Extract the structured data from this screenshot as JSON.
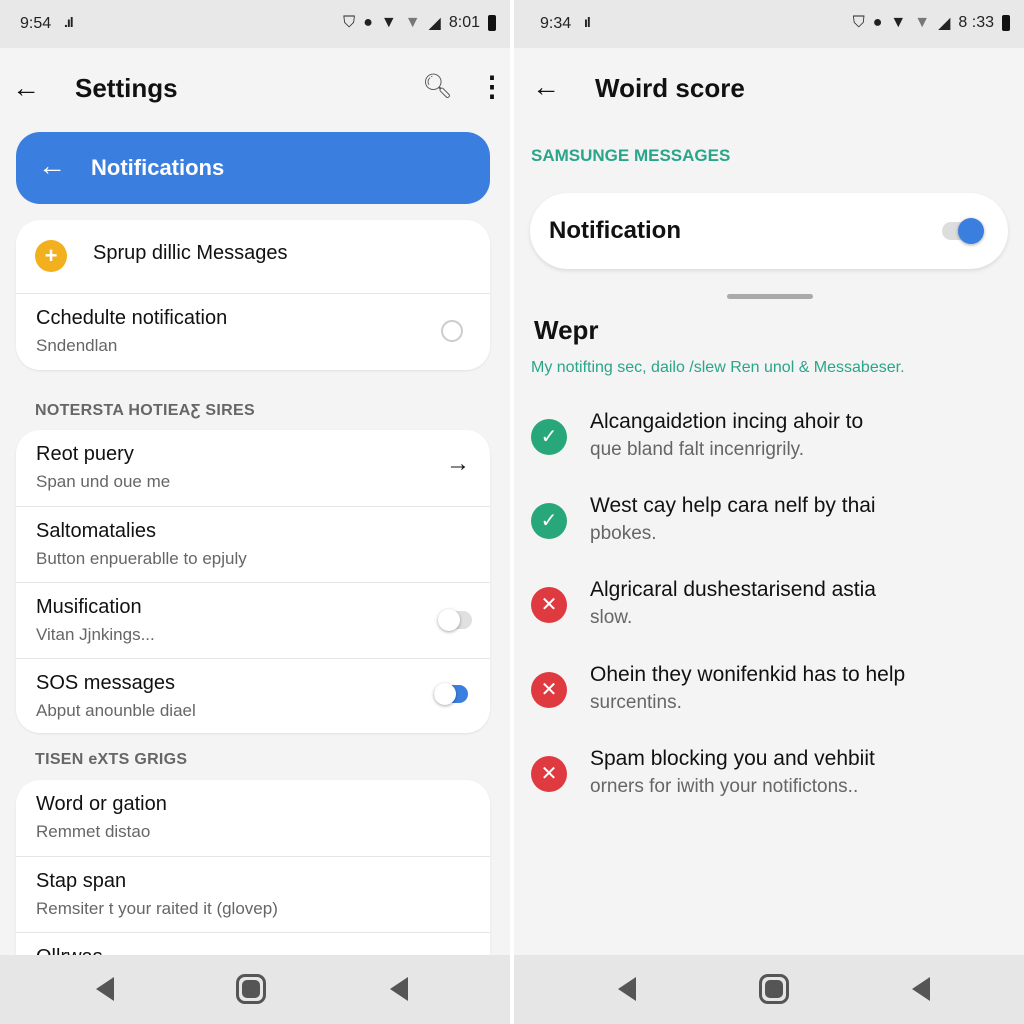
{
  "left": {
    "status": {
      "time": "9:54",
      "clock": "8:01"
    },
    "header": {
      "title": "Settings"
    },
    "banner": {
      "label": "Notifications"
    },
    "card1": [
      {
        "title": "Sprup dillic Messages",
        "icon": "plus-circle-icon"
      },
      {
        "title": "Cchedulte notification",
        "subtitle": "Sndendlan",
        "control": "radio"
      }
    ],
    "section1": "NOTERSTA HOTIEAƸ SIRES",
    "card2": [
      {
        "title": "Reot puery",
        "subtitle": "Span und oue me",
        "control": "arrow"
      },
      {
        "title": "Saltomatalies",
        "subtitle": "Button enpuerablle to epjuly"
      },
      {
        "title": "Musification",
        "subtitle": "Vitan Jjnkings...",
        "control": "toggle",
        "on": false
      },
      {
        "title": "SOS messages",
        "subtitle": "Abput anounble diael",
        "control": "toggle",
        "on": true
      }
    ],
    "section2": "TISEN eXTS GRIGS",
    "card3": [
      {
        "title": "Word or gation",
        "subtitle": "Remmet distao"
      },
      {
        "title": "Stap span",
        "subtitle": "Remsiter t your raited it (glovep)"
      },
      {
        "title": "Ollrwas"
      }
    ]
  },
  "right": {
    "status": {
      "time": "9:34",
      "clock": "8 :33"
    },
    "header": {
      "title": "Woird score"
    },
    "section": "SAMSUNGE MESSAGES",
    "notification": {
      "label": "Notification",
      "on": true
    },
    "heading": "Wepr",
    "description": "My notifting sec, dailo /slew Ren unol & Messabeser.",
    "items": [
      {
        "status": "check",
        "title": "Alcangaidƨtion incing ahoir to",
        "subtitle": "que bland falt incenrigrily."
      },
      {
        "status": "check",
        "title": "West cay help cara nelf by thai",
        "subtitle": "pbokes."
      },
      {
        "status": "cross",
        "title": "Algricaral dushestarisend astia",
        "subtitle": "slow."
      },
      {
        "status": "cross",
        "title": "Ohein they wonifenkid has to help",
        "subtitle": "surcentins."
      },
      {
        "status": "cross",
        "title": "Spam blocking you and vehbiit",
        "subtitle": "orners for iwith your notifictons.."
      }
    ]
  },
  "colors": {
    "accent": "#3a7fe0",
    "teal": "#2aa58a",
    "check": "#27a77a",
    "cross": "#de3a3f",
    "plus": "#f2b01e"
  }
}
